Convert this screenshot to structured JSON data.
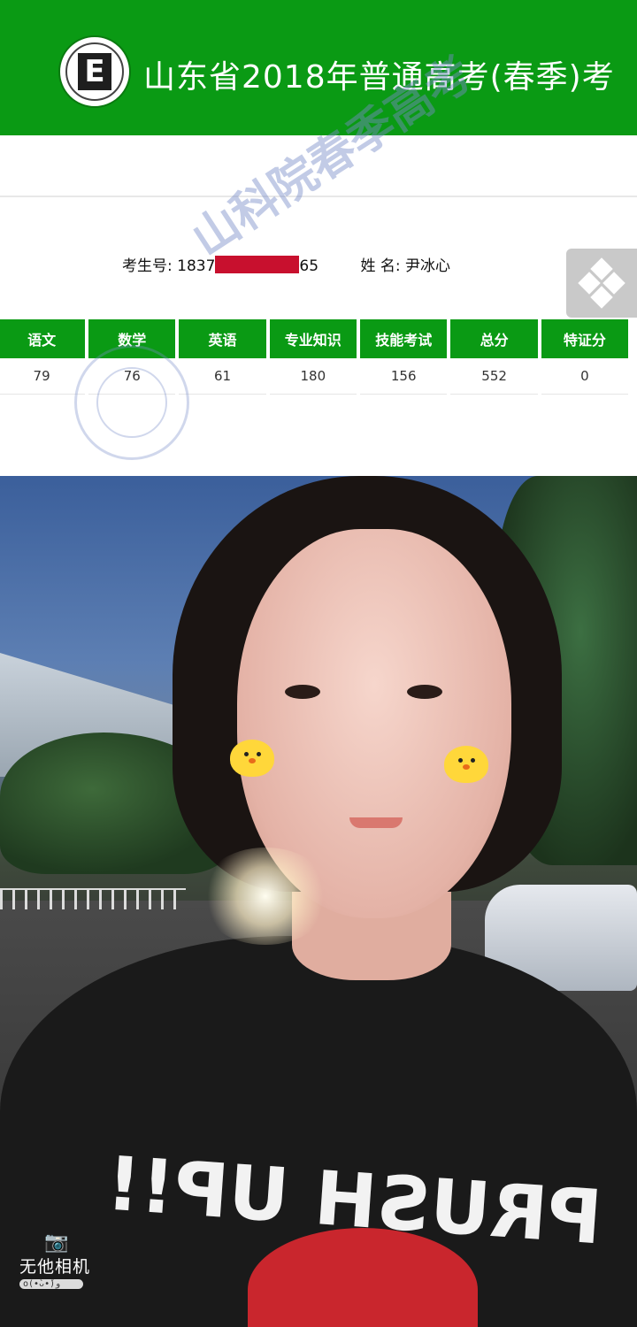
{
  "header": {
    "title": "山东省2018年普通高考(春季)考",
    "logo_icon": "school-logo-e-icon",
    "background": "#0a9a14"
  },
  "exam_info": {
    "exam_no_label": "考生号:",
    "exam_no_prefix": "1837",
    "exam_no_suffix": "65",
    "name_label": "姓 名:",
    "name_value": "尹冰心"
  },
  "scores": {
    "headers": [
      "语文",
      "数学",
      "英语",
      "专业知识",
      "技能考试",
      "总分",
      "特证分"
    ],
    "values": [
      "79",
      "76",
      "61",
      "180",
      "156",
      "552",
      "0"
    ]
  },
  "watermark": {
    "text": "山科院春季高考"
  },
  "corner_button": {
    "icon": "diamond-grid-icon"
  },
  "photo": {
    "shirt_text": "PRUSH UP!!",
    "camera_label": "无他相机",
    "camera_sub": "o(•̀ᴗ•́)و",
    "camera_icon": "camera-icon"
  }
}
